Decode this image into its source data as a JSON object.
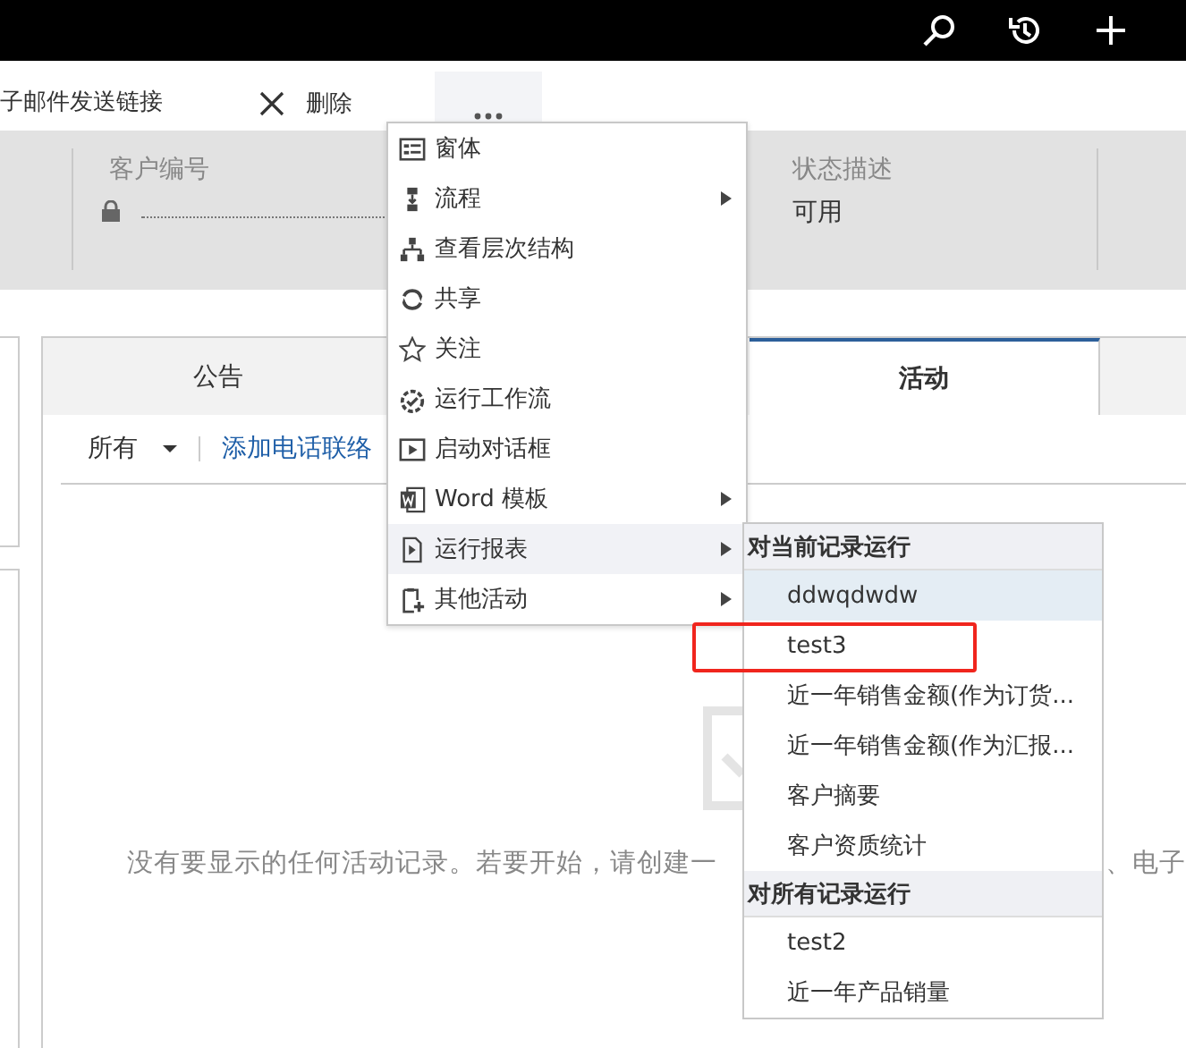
{
  "command_bar": {
    "items": [
      {
        "kind": "text",
        "label": "子邮件发送链接"
      },
      {
        "kind": "delete",
        "label": "删除"
      }
    ]
  },
  "header": {
    "fields": [
      {
        "label": "客户编号",
        "locked": true
      },
      {
        "label": "状态描述",
        "value": "可用"
      }
    ]
  },
  "tabs": [
    {
      "label": "公告",
      "selected": false
    },
    {
      "label": "活动",
      "selected": true
    }
  ],
  "filter": {
    "value": "所有",
    "link": "添加电话联络"
  },
  "empty_message": {
    "left": "没有要显示的任何活动记录。若要开始，请创建一",
    "right": "、电子"
  },
  "menu": {
    "items": [
      {
        "label": "窗体",
        "has_submenu": false,
        "selected": false
      },
      {
        "label": "流程",
        "has_submenu": true,
        "selected": false
      },
      {
        "label": "查看层次结构",
        "has_submenu": false,
        "selected": false
      },
      {
        "label": "共享",
        "has_submenu": false,
        "selected": false
      },
      {
        "label": "关注",
        "has_submenu": false,
        "selected": false
      },
      {
        "label": "运行工作流",
        "has_submenu": false,
        "selected": false
      },
      {
        "label": "启动对话框",
        "has_submenu": false,
        "selected": false
      },
      {
        "label": "Word 模板",
        "has_submenu": true,
        "selected": false
      },
      {
        "label": "运行报表",
        "has_submenu": true,
        "selected": true
      },
      {
        "label": "其他活动",
        "has_submenu": true,
        "selected": false
      }
    ]
  },
  "submenu": {
    "groups": [
      {
        "title": "对当前记录运行",
        "items": [
          {
            "label": "ddwqdwdw",
            "selected": true,
            "outlined": false
          },
          {
            "label": "test3",
            "selected": false,
            "outlined": true
          },
          {
            "label": "近一年销售金额(作为订货...",
            "selected": false,
            "outlined": false
          },
          {
            "label": "近一年销售金额(作为汇报...",
            "selected": false,
            "outlined": false
          },
          {
            "label": "客户摘要",
            "selected": false,
            "outlined": false
          },
          {
            "label": "客户资质统计",
            "selected": false,
            "outlined": false
          }
        ]
      },
      {
        "title": "对所有记录运行",
        "items": [
          {
            "label": "test2",
            "selected": false,
            "outlined": false
          },
          {
            "label": "近一年产品销量",
            "selected": false,
            "outlined": false
          }
        ]
      }
    ]
  }
}
